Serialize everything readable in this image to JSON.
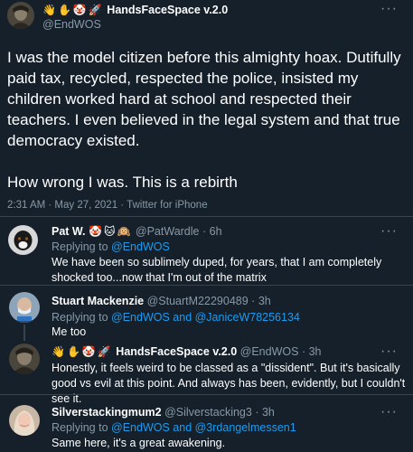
{
  "main_tweet": {
    "emojis": [
      "👋",
      "✋",
      "🤡",
      "🚀"
    ],
    "display_name": "HandsFaceSpace v.2.0",
    "handle": "@EndWOS",
    "text_p1": "I was the model citizen before this almighty hoax. Dutifully paid tax, recycled, respected the police, insisted my children worked hard at school and respected their teachers. I even believed in the legal system and that true democracy existed.",
    "text_p2": "How wrong I was. This is a rebirth",
    "meta": "2:31 AM · May 27, 2021 · Twitter for iPhone",
    "more": "···"
  },
  "replies": [
    {
      "display_name": "Pat W.",
      "emojis": [
        "🤡",
        "🐱",
        "🙉"
      ],
      "handle": "@PatWardle",
      "sep": "·",
      "time": "6h",
      "replying_prefix": "Replying to",
      "replying_to": "@EndWOS",
      "text": "We have been so sublimely duped, for years, that I am completely shocked too...now that I'm out of the matrix",
      "more": "···"
    },
    {
      "display_name": "Stuart Mackenzie",
      "handle": "@StuartM22290489",
      "sep": "·",
      "time": "3h",
      "replying_prefix": "Replying to",
      "replying_to": "@EndWOS and @JaniceW78256134",
      "text": "Me too",
      "more": "···"
    },
    {
      "emojis": [
        "👋",
        "✋",
        "🤡",
        "🚀"
      ],
      "display_name": "HandsFaceSpace v.2.0",
      "handle": "@EndWOS",
      "sep": "·",
      "time": "3h",
      "text": "Honestly, it feels weird to be classed as a \"dissident\". But it's basically good vs evil at this point. And always has been, evidently, but I couldn't see it.",
      "more": "···"
    },
    {
      "display_name": "Silverstackingmum2",
      "handle": "@Silverstacking3",
      "sep": "·",
      "time": "3h",
      "replying_prefix": "Replying to",
      "replying_to": "@EndWOS and @3rdangelmessen1",
      "text": "Same here, it's a great awakening.",
      "more": "···"
    }
  ],
  "colors": {
    "background": "#15202b",
    "divider": "#38444d",
    "muted": "#8899a6",
    "link": "#1d9bf0"
  }
}
